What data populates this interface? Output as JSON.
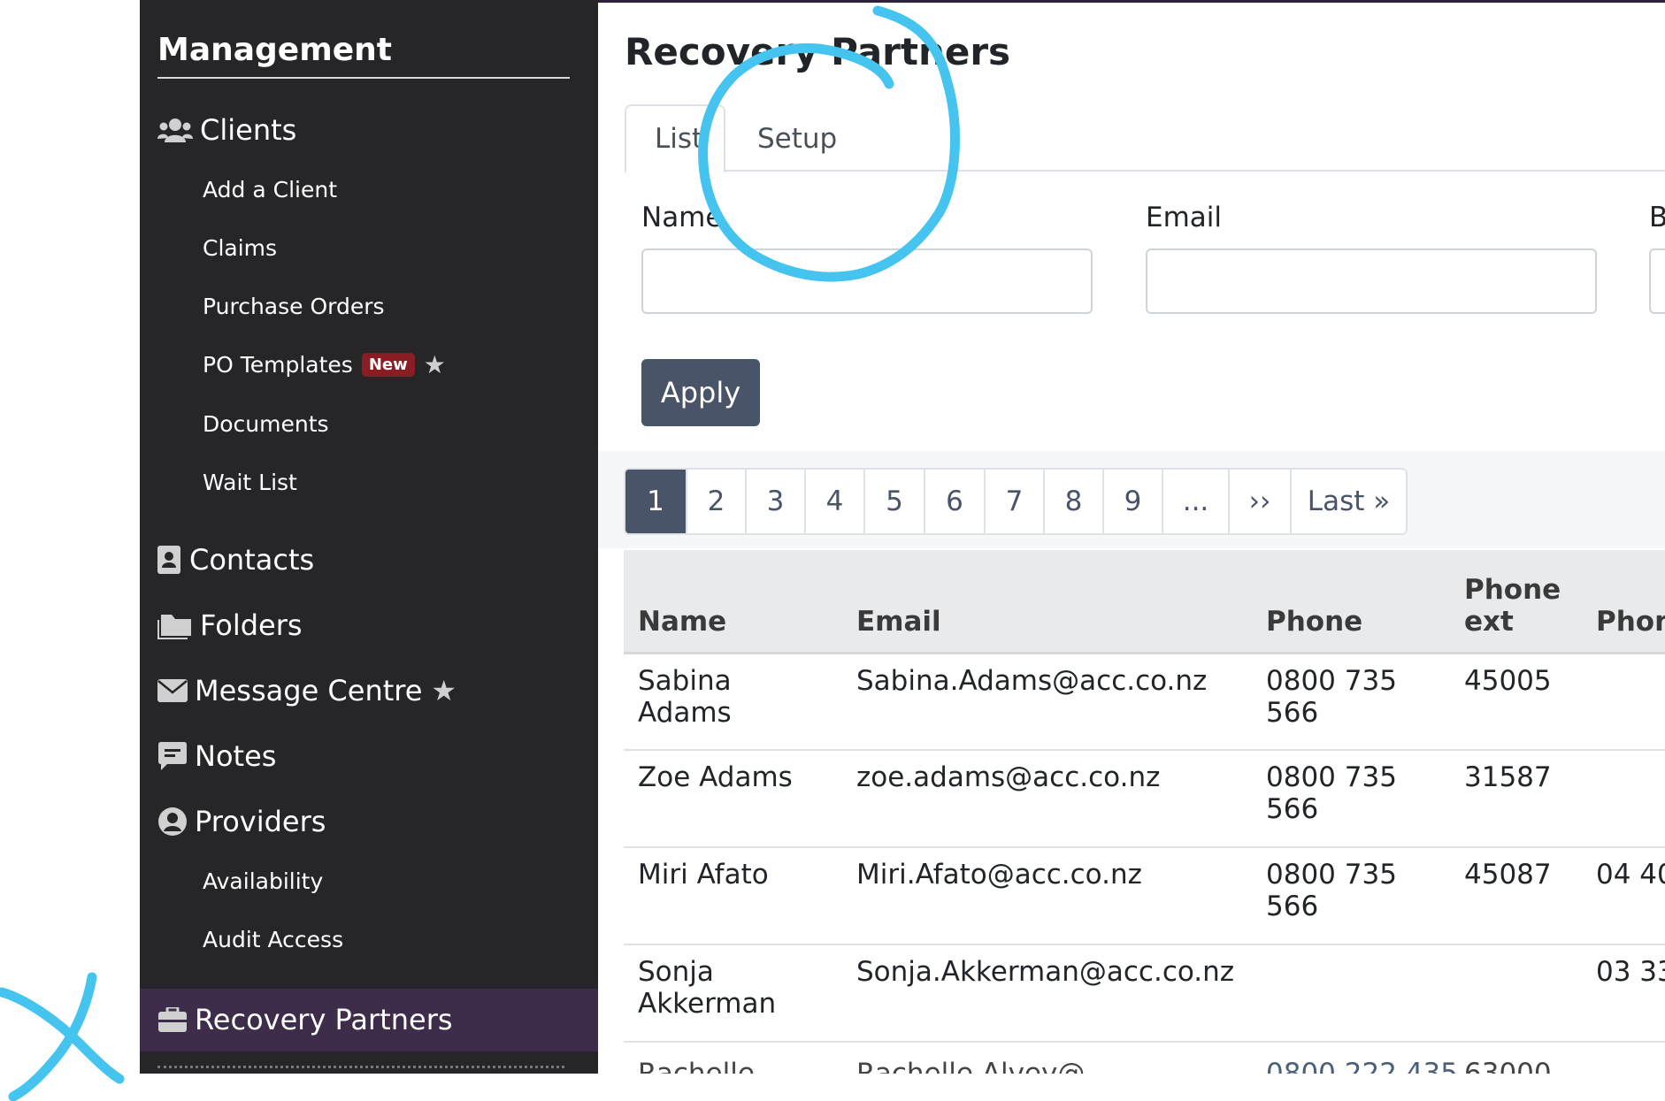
{
  "sidebar": {
    "title": "Management",
    "clients": {
      "label": "Clients",
      "items": [
        "Add a Client",
        "Claims",
        "Purchase Orders",
        "PO Templates",
        "Documents",
        "Wait List"
      ],
      "po_templates_badge": "New"
    },
    "contacts_label": "Contacts",
    "folders_label": "Folders",
    "message_centre_label": "Message Centre",
    "notes_label": "Notes",
    "providers": {
      "label": "Providers",
      "items": [
        "Availability",
        "Audit Access"
      ]
    },
    "recovery_partners_label": "Recovery Partners"
  },
  "main": {
    "page_title": "Recovery Partners",
    "tabs": [
      {
        "label": "List",
        "active": true
      },
      {
        "label": "Setup",
        "active": false
      }
    ],
    "filters": {
      "name_label": "Name",
      "email_label": "Email",
      "third_label": "B",
      "name_value": "",
      "email_value": ""
    },
    "apply_label": "Apply",
    "pagination": [
      "1",
      "2",
      "3",
      "4",
      "5",
      "6",
      "7",
      "8",
      "9",
      "...",
      "››",
      "Last »"
    ],
    "current_page": "1",
    "table": {
      "headers": [
        "Name",
        "Email",
        "Phone",
        "Phone ext",
        "Phon"
      ],
      "rows": [
        {
          "name": "Sabina Adams",
          "email": "Sabina.Adams@acc.co.nz",
          "phone": "0800 735 566",
          "ext": "45005",
          "phone2": ""
        },
        {
          "name": "Zoe Adams",
          "email": "zoe.adams@acc.co.nz",
          "phone": "0800 735 566",
          "ext": "31587",
          "phone2": ""
        },
        {
          "name": "Miri Afato",
          "email": "Miri.Afato@acc.co.nz",
          "phone": "0800 735 566",
          "ext": "45087",
          "phone2": "04 40"
        },
        {
          "name": "Sonja Akkerman",
          "email": "Sonja.Akkerman@acc.co.nz",
          "phone": "",
          "ext": "",
          "phone2": "03 33"
        }
      ],
      "partial_row": {
        "name": "Rachelle",
        "email": "Rachelle.Alvey@",
        "phone": "0800 222 435",
        "ext": "63000"
      }
    }
  },
  "colors": {
    "sidebar_bg": "#262528",
    "sidebar_active_bg": "#3d2c4a",
    "primary_button": "#4a5468",
    "badge_new": "#8a1d23",
    "annotation_blue": "#44c4ee"
  },
  "icons": [
    "users-icon",
    "contact-card-icon",
    "folder-icon",
    "envelope-icon",
    "note-icon",
    "user-circle-icon",
    "briefcase-icon",
    "star-icon"
  ]
}
